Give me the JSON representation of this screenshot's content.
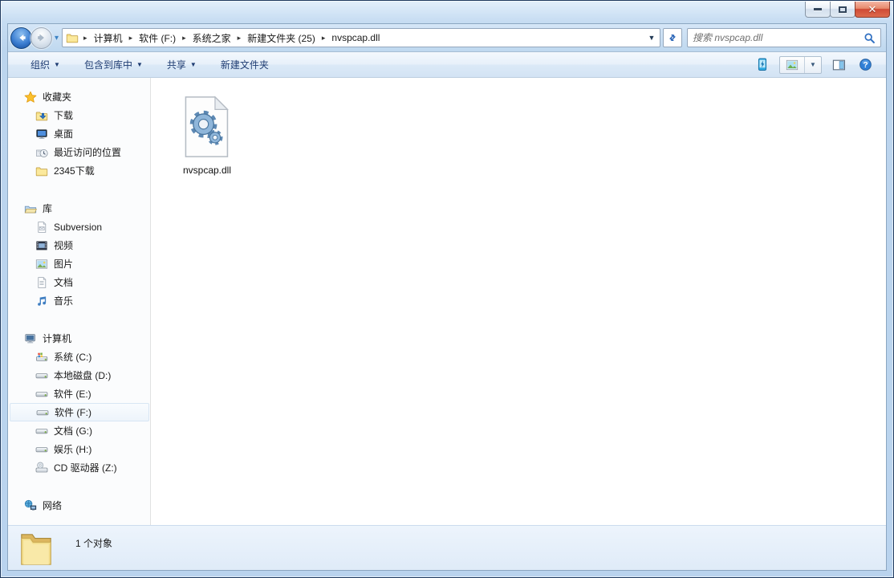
{
  "titlebar": {
    "buttons": [
      {
        "name": "minimize",
        "icon": "minimize-icon"
      },
      {
        "name": "maximize",
        "icon": "maximize-icon"
      },
      {
        "name": "close",
        "icon": "close-icon"
      }
    ]
  },
  "navbar": {
    "back_icon": "back-arrow-icon",
    "forward_icon": "forward-arrow-icon",
    "history_dropdown_icon": "chevron-down-icon",
    "address_icon": "folder-icon",
    "breadcrumb": [
      "计算机",
      "软件 (F:)",
      "系统之家",
      "新建文件夹 (25)",
      "nvspcap.dll"
    ],
    "address_dropdown_icon": "chevron-down-icon",
    "refresh_icon": "refresh-icon",
    "search": {
      "placeholder": "搜索 nvspcap.dll",
      "value": "",
      "icon": "search-icon"
    }
  },
  "toolbar": {
    "items": [
      {
        "label": "组织",
        "dropdown": true
      },
      {
        "label": "包含到库中",
        "dropdown": true
      },
      {
        "label": "共享",
        "dropdown": true
      },
      {
        "label": "新建文件夹",
        "dropdown": false
      }
    ],
    "right_icons": [
      {
        "icon": "device"
      },
      {
        "icon": "views",
        "split_dropdown": true
      },
      {
        "icon": "preview"
      },
      {
        "icon": "help"
      }
    ]
  },
  "sidebar": {
    "sections": [
      {
        "label": "收藏夹",
        "icon": "star",
        "items": [
          {
            "label": "下载",
            "icon": "folder-download"
          },
          {
            "label": "桌面",
            "icon": "desktop"
          },
          {
            "label": "最近访问的位置",
            "icon": "recent"
          },
          {
            "label": "2345下载",
            "icon": "folder"
          }
        ]
      },
      {
        "label": "库",
        "icon": "library",
        "items": [
          {
            "label": "Subversion",
            "icon": "doc-env"
          },
          {
            "label": "视频",
            "icon": "video"
          },
          {
            "label": "图片",
            "icon": "picture"
          },
          {
            "label": "文档",
            "icon": "doc"
          },
          {
            "label": "音乐",
            "icon": "music"
          }
        ]
      },
      {
        "label": "计算机",
        "icon": "computer",
        "items": [
          {
            "label": "系统 (C:)",
            "icon": "drive-win"
          },
          {
            "label": "本地磁盘 (D:)",
            "icon": "drive"
          },
          {
            "label": "软件 (E:)",
            "icon": "drive"
          },
          {
            "label": "软件 (F:)",
            "icon": "drive",
            "selected": true
          },
          {
            "label": "文档 (G:)",
            "icon": "drive"
          },
          {
            "label": "娱乐 (H:)",
            "icon": "drive"
          },
          {
            "label": "CD 驱动器 (Z:)",
            "icon": "cd"
          }
        ]
      },
      {
        "label": "网络",
        "icon": "network",
        "items": []
      }
    ]
  },
  "files": [
    {
      "name": "nvspcap.dll",
      "icon": "dll"
    }
  ],
  "statusbar": {
    "label": "1 个对象",
    "icon": "folder-big"
  },
  "colors": {
    "close_button": "#d9553f",
    "toolbar_text": "#1e3c72",
    "frame_blue": "#b9d3ee",
    "selection_border": "#d8e6f4"
  }
}
